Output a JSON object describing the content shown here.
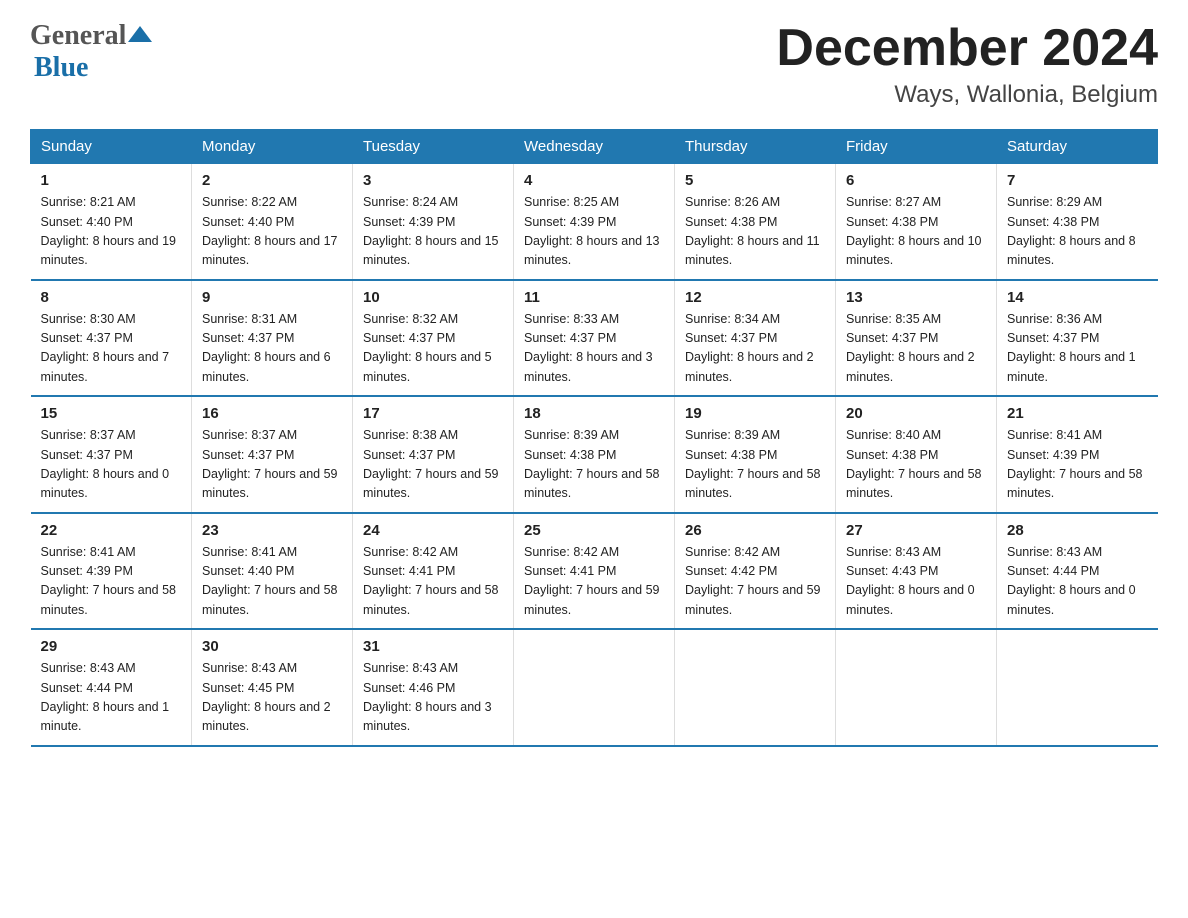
{
  "header": {
    "logo_general": "General",
    "logo_blue": "Blue",
    "month_title": "December 2024",
    "location": "Ways, Wallonia, Belgium"
  },
  "days_of_week": [
    "Sunday",
    "Monday",
    "Tuesday",
    "Wednesday",
    "Thursday",
    "Friday",
    "Saturday"
  ],
  "weeks": [
    [
      {
        "day": "1",
        "sunrise": "Sunrise: 8:21 AM",
        "sunset": "Sunset: 4:40 PM",
        "daylight": "Daylight: 8 hours and 19 minutes."
      },
      {
        "day": "2",
        "sunrise": "Sunrise: 8:22 AM",
        "sunset": "Sunset: 4:40 PM",
        "daylight": "Daylight: 8 hours and 17 minutes."
      },
      {
        "day": "3",
        "sunrise": "Sunrise: 8:24 AM",
        "sunset": "Sunset: 4:39 PM",
        "daylight": "Daylight: 8 hours and 15 minutes."
      },
      {
        "day": "4",
        "sunrise": "Sunrise: 8:25 AM",
        "sunset": "Sunset: 4:39 PM",
        "daylight": "Daylight: 8 hours and 13 minutes."
      },
      {
        "day": "5",
        "sunrise": "Sunrise: 8:26 AM",
        "sunset": "Sunset: 4:38 PM",
        "daylight": "Daylight: 8 hours and 11 minutes."
      },
      {
        "day": "6",
        "sunrise": "Sunrise: 8:27 AM",
        "sunset": "Sunset: 4:38 PM",
        "daylight": "Daylight: 8 hours and 10 minutes."
      },
      {
        "day": "7",
        "sunrise": "Sunrise: 8:29 AM",
        "sunset": "Sunset: 4:38 PM",
        "daylight": "Daylight: 8 hours and 8 minutes."
      }
    ],
    [
      {
        "day": "8",
        "sunrise": "Sunrise: 8:30 AM",
        "sunset": "Sunset: 4:37 PM",
        "daylight": "Daylight: 8 hours and 7 minutes."
      },
      {
        "day": "9",
        "sunrise": "Sunrise: 8:31 AM",
        "sunset": "Sunset: 4:37 PM",
        "daylight": "Daylight: 8 hours and 6 minutes."
      },
      {
        "day": "10",
        "sunrise": "Sunrise: 8:32 AM",
        "sunset": "Sunset: 4:37 PM",
        "daylight": "Daylight: 8 hours and 5 minutes."
      },
      {
        "day": "11",
        "sunrise": "Sunrise: 8:33 AM",
        "sunset": "Sunset: 4:37 PM",
        "daylight": "Daylight: 8 hours and 3 minutes."
      },
      {
        "day": "12",
        "sunrise": "Sunrise: 8:34 AM",
        "sunset": "Sunset: 4:37 PM",
        "daylight": "Daylight: 8 hours and 2 minutes."
      },
      {
        "day": "13",
        "sunrise": "Sunrise: 8:35 AM",
        "sunset": "Sunset: 4:37 PM",
        "daylight": "Daylight: 8 hours and 2 minutes."
      },
      {
        "day": "14",
        "sunrise": "Sunrise: 8:36 AM",
        "sunset": "Sunset: 4:37 PM",
        "daylight": "Daylight: 8 hours and 1 minute."
      }
    ],
    [
      {
        "day": "15",
        "sunrise": "Sunrise: 8:37 AM",
        "sunset": "Sunset: 4:37 PM",
        "daylight": "Daylight: 8 hours and 0 minutes."
      },
      {
        "day": "16",
        "sunrise": "Sunrise: 8:37 AM",
        "sunset": "Sunset: 4:37 PM",
        "daylight": "Daylight: 7 hours and 59 minutes."
      },
      {
        "day": "17",
        "sunrise": "Sunrise: 8:38 AM",
        "sunset": "Sunset: 4:37 PM",
        "daylight": "Daylight: 7 hours and 59 minutes."
      },
      {
        "day": "18",
        "sunrise": "Sunrise: 8:39 AM",
        "sunset": "Sunset: 4:38 PM",
        "daylight": "Daylight: 7 hours and 58 minutes."
      },
      {
        "day": "19",
        "sunrise": "Sunrise: 8:39 AM",
        "sunset": "Sunset: 4:38 PM",
        "daylight": "Daylight: 7 hours and 58 minutes."
      },
      {
        "day": "20",
        "sunrise": "Sunrise: 8:40 AM",
        "sunset": "Sunset: 4:38 PM",
        "daylight": "Daylight: 7 hours and 58 minutes."
      },
      {
        "day": "21",
        "sunrise": "Sunrise: 8:41 AM",
        "sunset": "Sunset: 4:39 PM",
        "daylight": "Daylight: 7 hours and 58 minutes."
      }
    ],
    [
      {
        "day": "22",
        "sunrise": "Sunrise: 8:41 AM",
        "sunset": "Sunset: 4:39 PM",
        "daylight": "Daylight: 7 hours and 58 minutes."
      },
      {
        "day": "23",
        "sunrise": "Sunrise: 8:41 AM",
        "sunset": "Sunset: 4:40 PM",
        "daylight": "Daylight: 7 hours and 58 minutes."
      },
      {
        "day": "24",
        "sunrise": "Sunrise: 8:42 AM",
        "sunset": "Sunset: 4:41 PM",
        "daylight": "Daylight: 7 hours and 58 minutes."
      },
      {
        "day": "25",
        "sunrise": "Sunrise: 8:42 AM",
        "sunset": "Sunset: 4:41 PM",
        "daylight": "Daylight: 7 hours and 59 minutes."
      },
      {
        "day": "26",
        "sunrise": "Sunrise: 8:42 AM",
        "sunset": "Sunset: 4:42 PM",
        "daylight": "Daylight: 7 hours and 59 minutes."
      },
      {
        "day": "27",
        "sunrise": "Sunrise: 8:43 AM",
        "sunset": "Sunset: 4:43 PM",
        "daylight": "Daylight: 8 hours and 0 minutes."
      },
      {
        "day": "28",
        "sunrise": "Sunrise: 8:43 AM",
        "sunset": "Sunset: 4:44 PM",
        "daylight": "Daylight: 8 hours and 0 minutes."
      }
    ],
    [
      {
        "day": "29",
        "sunrise": "Sunrise: 8:43 AM",
        "sunset": "Sunset: 4:44 PM",
        "daylight": "Daylight: 8 hours and 1 minute."
      },
      {
        "day": "30",
        "sunrise": "Sunrise: 8:43 AM",
        "sunset": "Sunset: 4:45 PM",
        "daylight": "Daylight: 8 hours and 2 minutes."
      },
      {
        "day": "31",
        "sunrise": "Sunrise: 8:43 AM",
        "sunset": "Sunset: 4:46 PM",
        "daylight": "Daylight: 8 hours and 3 minutes."
      },
      null,
      null,
      null,
      null
    ]
  ],
  "colors": {
    "header_bg": "#2178b0",
    "header_text": "#ffffff",
    "border": "#2178b0"
  }
}
